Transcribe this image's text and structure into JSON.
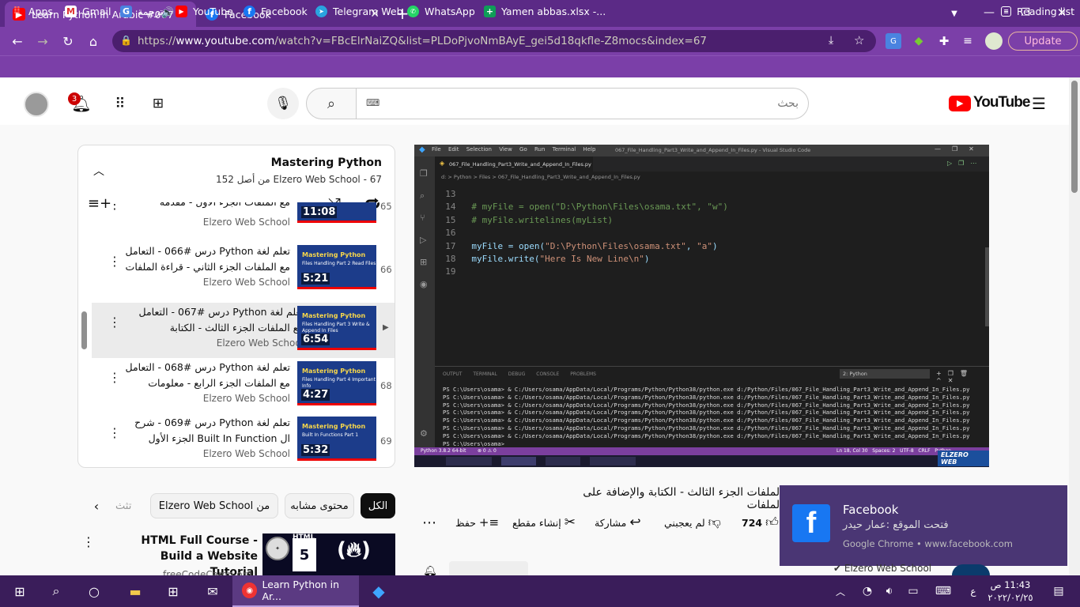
{
  "browser": {
    "tabs": [
      {
        "title": "Learn Python in Arabic #067",
        "active": true
      },
      {
        "title": "Facebook",
        "active": false
      }
    ],
    "url_prefix": "https://",
    "url_host": "www.youtube.com",
    "url_rest": "/watch?v=FBcElrNaiZQ&list=PLDoPjvoNmBAyE_gei5d18qkfle-Z8mocs&index=67",
    "update_label": "Update",
    "reading_list_label": "Reading list",
    "bookmarks": [
      "Apps",
      "Gmail",
      "ترجمة",
      "YouTube",
      "Facebook",
      "Telegram Web",
      "WhatsApp",
      "Yamen abbas.xlsx -..."
    ]
  },
  "youtube": {
    "notif_count": "3",
    "search_placeholder": "بحث",
    "logo": "YouTube"
  },
  "playlist": {
    "title": "Mastering Python",
    "subtitle": "Elzero Web School - 67 من أصل 152",
    "rows": [
      {
        "num": "65",
        "title": "مع الملفات الجزء الأول - مقدمة",
        "channel": "Elzero Web School",
        "duration": "11:08",
        "thumb_title": "",
        "thumb_sub": ""
      },
      {
        "num": "66",
        "title": "تعلم لغة Python درس #066 - التعامل مع الملفات الجزء الثاني - قراءة الملفات",
        "channel": "Elzero Web School",
        "duration": "5:21",
        "thumb_title": "Mastering Python",
        "thumb_sub": "Files Handling Part 2 Read Files"
      },
      {
        "num": "",
        "title": "تعلم لغة Python درس #067 - التعامل مع الملفات الجزء الثالث - الكتابة والإضاف...",
        "channel": "Elzero Web School",
        "duration": "6:54",
        "thumb_title": "Mastering Python",
        "thumb_sub": "Files Handling Part 3 Write & Append In Files"
      },
      {
        "num": "68",
        "title": "تعلم لغة Python درس #068 - التعامل مع الملفات الجزء الرابع - معلومات مهمة",
        "channel": "Elzero Web School",
        "duration": "4:27",
        "thumb_title": "Mastering Python",
        "thumb_sub": "Files Handling Part 4 Important Info"
      },
      {
        "num": "69",
        "title": "تعلم لغة Python درس #069 - شرح ال Built In Function الجزء الأول",
        "channel": "Elzero Web School",
        "duration": "5:32",
        "thumb_title": "Mastering Python",
        "thumb_sub": "Built In Functions Part 1"
      }
    ]
  },
  "chips": [
    "الكل",
    "من Elzero Web School",
    "محتوى مشابه",
    "تثث"
  ],
  "suggested": {
    "title": "HTML Full Course - Build a Website Tutorial",
    "channel": "freeCodeCamp.org",
    "thumb_label": "HTML"
  },
  "vscode": {
    "menu": [
      "File",
      "Edit",
      "Selection",
      "View",
      "Go",
      "Run",
      "Terminal",
      "Help"
    ],
    "window_title": "067_File_Handling_Part3_Write_and_Append_In_Files.py - Visual Studio Code",
    "tab": "067_File_Handling_Part3_Write_and_Append_In_Files.py",
    "breadcrumb": "d: > Python > Files > 067_File_Handling_Part3_Write_and_Append_In_Files.py",
    "code": [
      {
        "n": "13",
        "t": ""
      },
      {
        "n": "14",
        "t": "# myFile = open(\"D:\\Python\\Files\\osama.txt\", \"w\")"
      },
      {
        "n": "15",
        "t": "# myFile.writelines(myList)"
      },
      {
        "n": "16",
        "t": ""
      },
      {
        "n": "17",
        "t": "myFile = open(\"D:\\Python\\Files\\osama.txt\", \"a\")"
      },
      {
        "n": "18",
        "t": "myFile.write(\"Here Is New Line\\n\")"
      },
      {
        "n": "19",
        "t": ""
      }
    ],
    "panel_tabs": [
      "OUTPUT",
      "TERMINAL",
      "DEBUG CONSOLE",
      "PROBLEMS"
    ],
    "terminal_select": "2: Python",
    "terminal_line": "PS C:\\Users\\osama> & C:/Users/osama/AppData/Local/Programs/Python/Python38/python.exe d:/Python/Files/067_File_Handling_Part3_Write_and_Append_In_Files.py",
    "terminal_prompt": "PS C:\\Users\\osama> ",
    "status_left": "Python 3.8.2 64-bit",
    "status_right": "Ln 18, Col 30   Spaces: 2   UTF-8   CRLF   Python",
    "watermark": "ELZERO WEB"
  },
  "video_title": "الملفات الجزء الثالث - الكتابة والإضافة على الملفات",
  "actions": {
    "likes": "724",
    "dislike": "لم يعجبني",
    "share": "مشاركة",
    "clip": "إنشاء مقطع",
    "save": "حفظ"
  },
  "channel_name": "Elzero Web School",
  "notification": {
    "title": "Facebook",
    "body": "فتحت الموقع :عمار حيدر",
    "source": "Google Chrome • www.facebook.com"
  },
  "taskbar": {
    "chrome_label": "Learn Python in Ar...",
    "time": "11:43 ص",
    "date": "٢٠٢٢/٠٢/٢٥",
    "lang": "ع"
  }
}
